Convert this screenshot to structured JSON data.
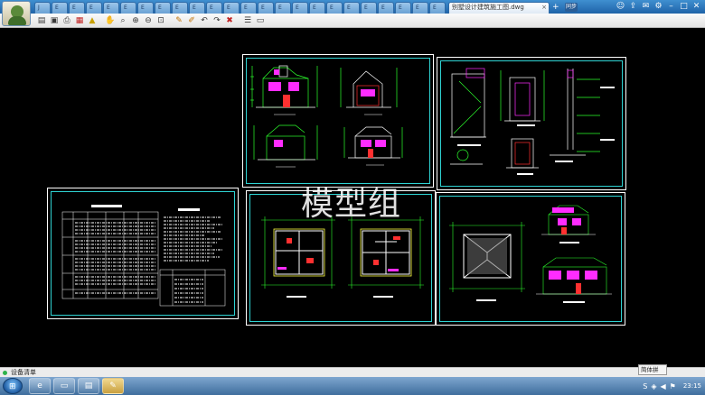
{
  "tabs": {
    "items": [
      "J",
      "E",
      "E",
      "E",
      "E",
      "E",
      "E",
      "E",
      "E",
      "E",
      "E",
      "E",
      "E",
      "E",
      "E",
      "E",
      "E"
    ],
    "active_label": "别墅设计建筑施工图.dwg",
    "close_glyph": "×",
    "add_glyph": "+",
    "sync_label": "同步"
  },
  "toolbar": {
    "icons": [
      "open-icon",
      "save-icon",
      "print-icon",
      "export-icon",
      "lock-icon",
      "pan-icon",
      "zoom-window-icon",
      "zoom-in-icon",
      "zoom-out-icon",
      "zoom-extents-icon",
      "pencil-icon",
      "marker-icon",
      "undo-icon",
      "redo-icon",
      "delete-icon",
      "layers-icon",
      "view-icon"
    ]
  },
  "watermark": {
    "text": "模型组"
  },
  "status": {
    "label": "设备清单"
  },
  "language_bar": {
    "label": "简体拼"
  },
  "taskbar": {
    "time": "23:15",
    "apps": [
      "explorer-icon",
      "folder-icon",
      "media-icon",
      "cad-viewer-icon"
    ]
  },
  "colors": {
    "frame_cyan": "#2fd3d3",
    "line_green": "#2cff2c",
    "line_magenta": "#ff2cff",
    "line_red": "#ff3030",
    "line_yellow": "#ffff40"
  }
}
